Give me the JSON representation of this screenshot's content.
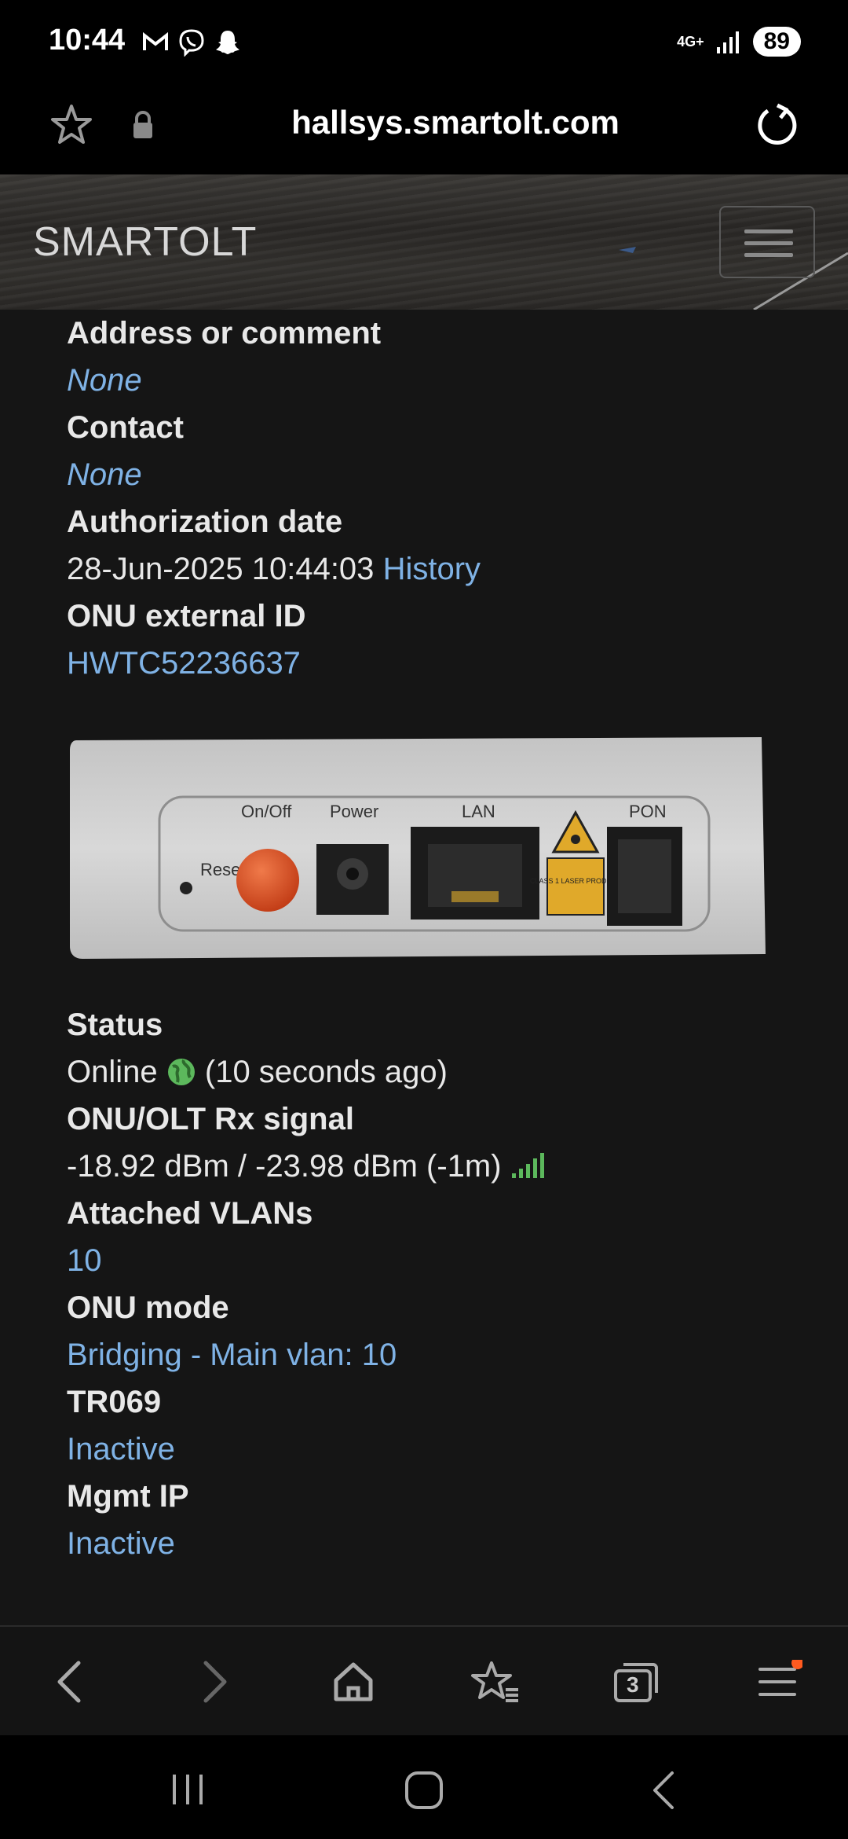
{
  "status_bar": {
    "time": "10:44",
    "network": "4G+",
    "battery": "89"
  },
  "browser": {
    "url": "hallsys.smartolt.com",
    "tab_count": "3"
  },
  "site": {
    "brand": "SMARTOLT"
  },
  "details": {
    "address_label": "Address or comment",
    "address_value": "None",
    "contact_label": "Contact",
    "contact_value": "None",
    "auth_date_label": "Authorization date",
    "auth_date_value": "28-Jun-2025 10:44:03",
    "history_link": "History",
    "external_id_label": "ONU external ID",
    "external_id_value": "HWTC52236637"
  },
  "device_image": {
    "labels": {
      "reset": "Reset",
      "onoff": "On/Off",
      "power": "Power",
      "lan": "LAN",
      "pon": "PON",
      "laser": "CLASS 1 LASER PRODUCT"
    }
  },
  "status": {
    "status_label": "Status",
    "status_value": "Online",
    "status_ago": "(10 seconds ago)",
    "rx_label": "ONU/OLT Rx signal",
    "rx_value": "-18.92 dBm / -23.98 dBm (-1m)",
    "vlans_label": "Attached VLANs",
    "vlans_value": "10",
    "mode_label": "ONU mode",
    "mode_value": "Bridging - Main vlan: 10",
    "tr069_label": "TR069",
    "tr069_value": "Inactive",
    "mgmt_label": "Mgmt IP",
    "mgmt_value": "Inactive"
  },
  "colors": {
    "link": "#7fb2e5",
    "online_green": "#5cb85c",
    "background": "#151515"
  }
}
